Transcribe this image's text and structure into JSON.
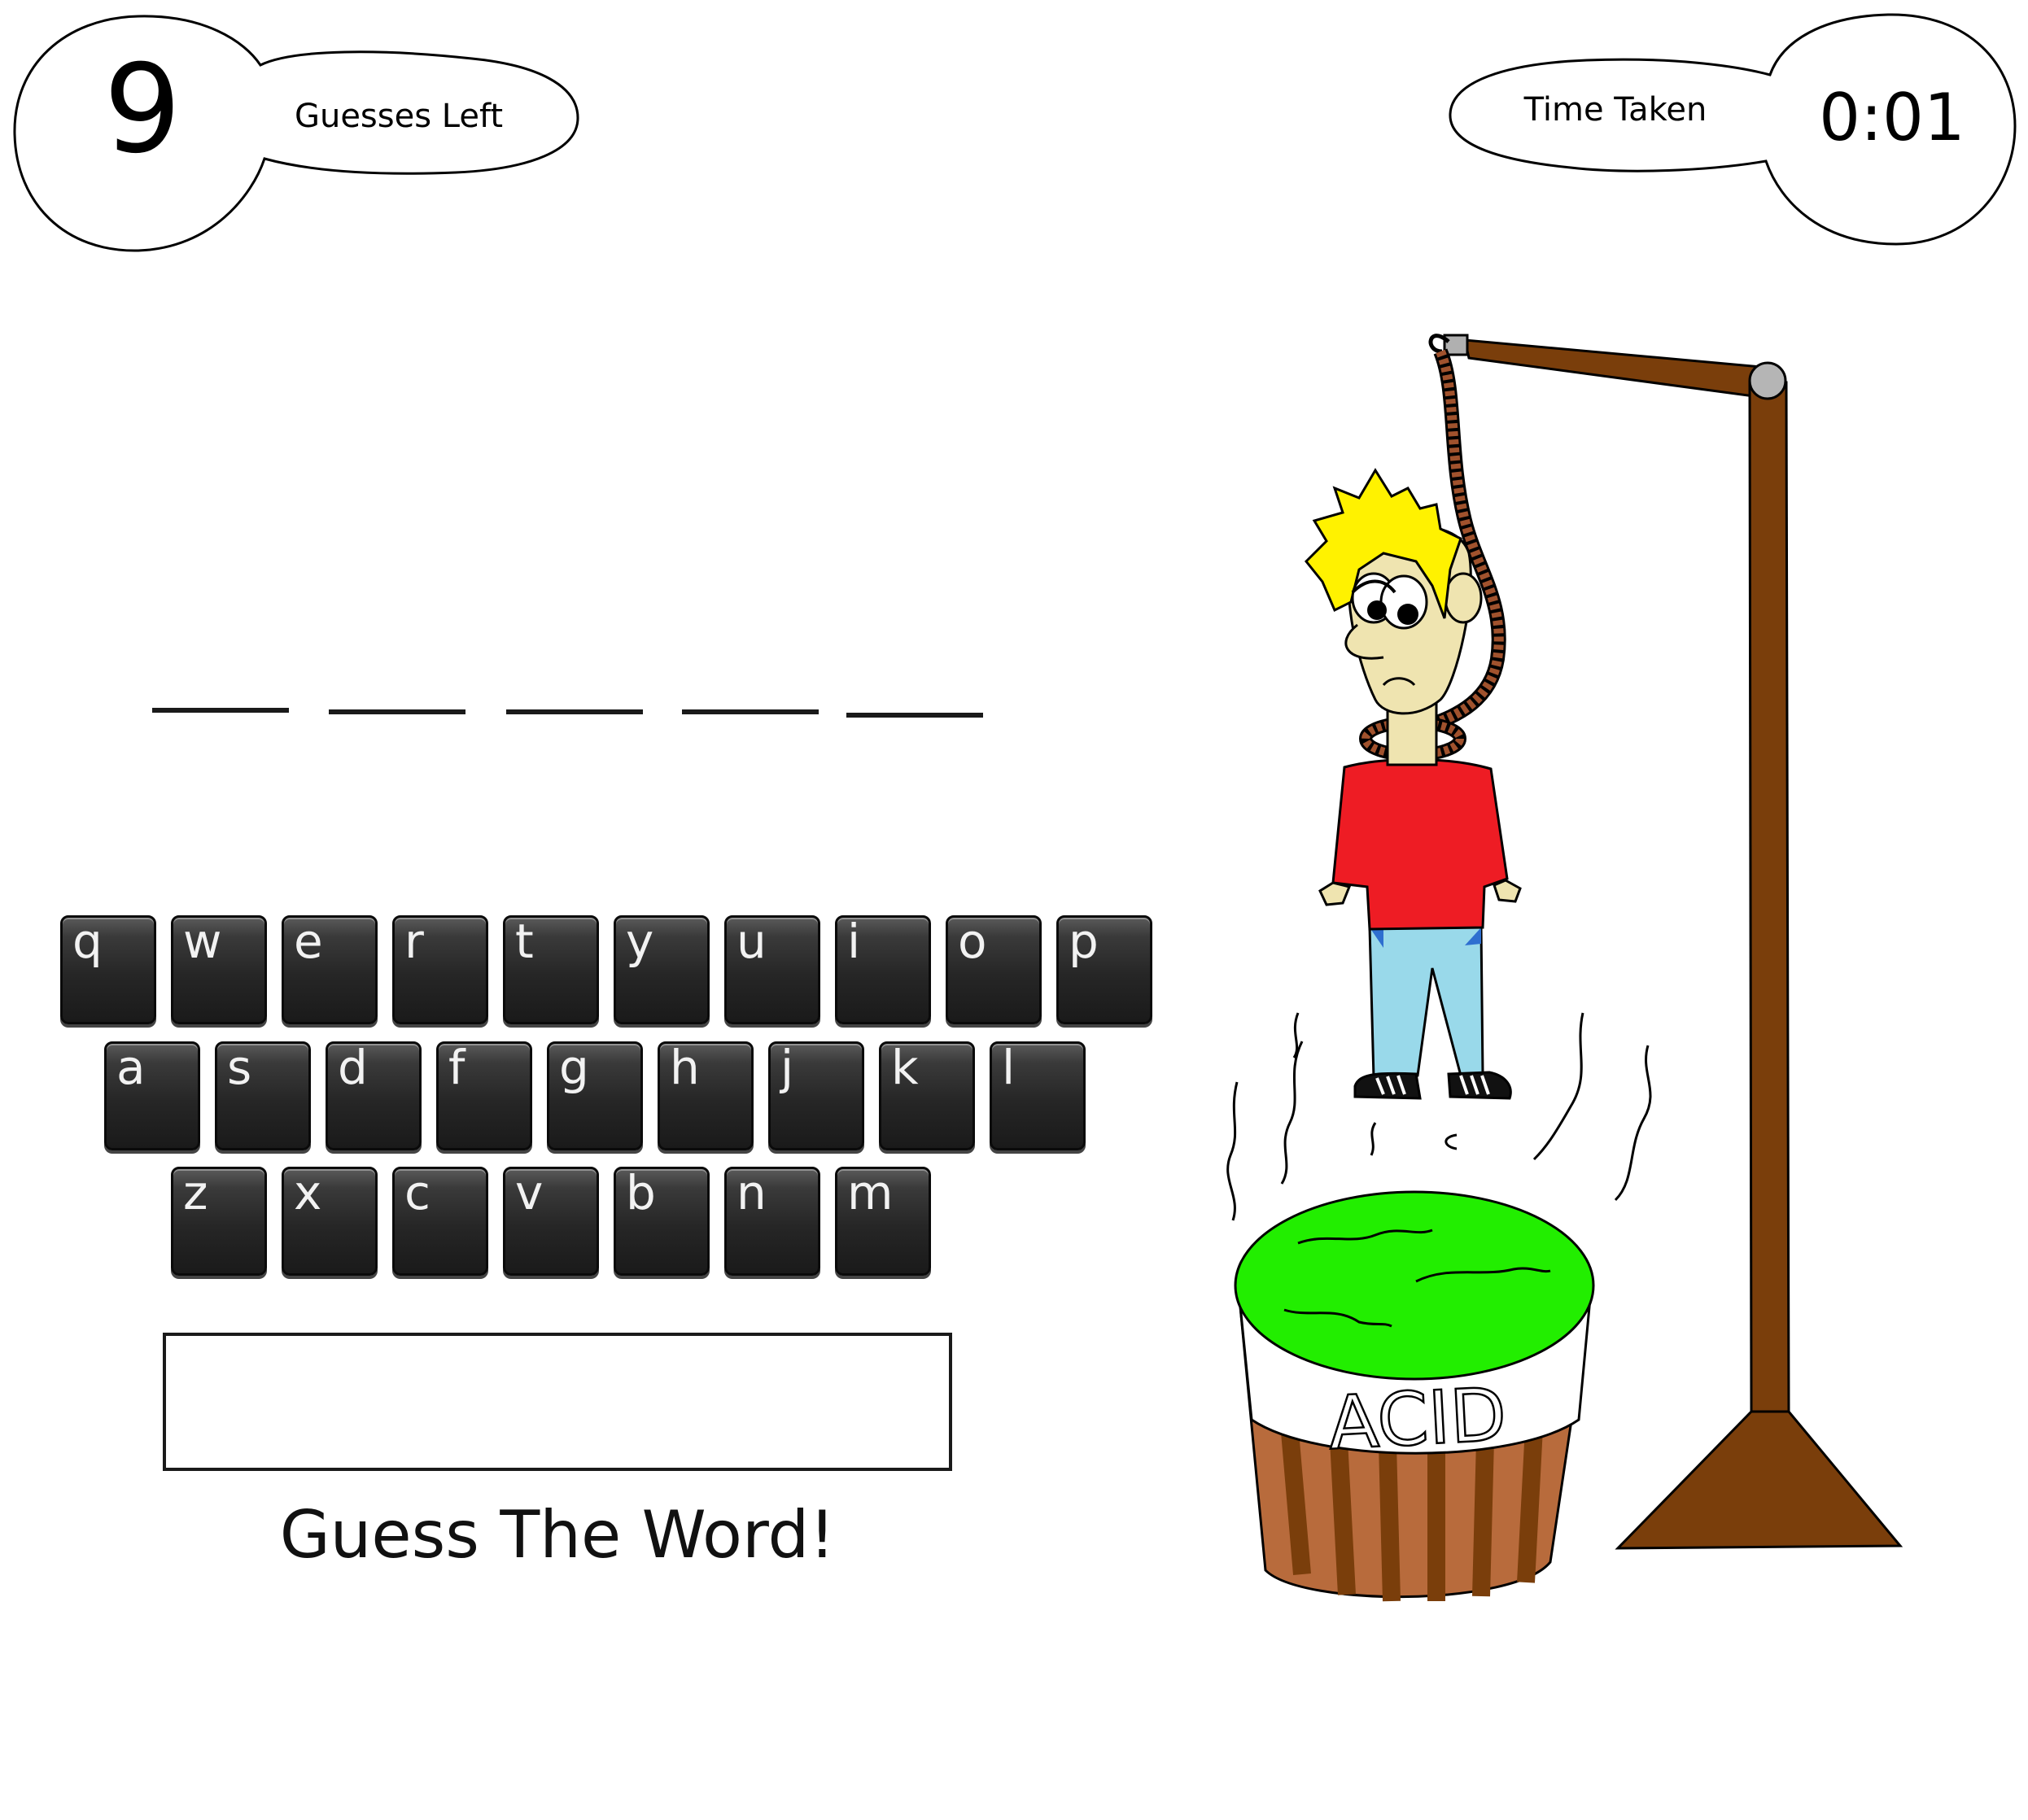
{
  "counter": {
    "value": "9",
    "label": "Guesses Left"
  },
  "timer": {
    "label": "Time Taken",
    "value": "0:01"
  },
  "word_slots": [
    "",
    "",
    "",
    "",
    ""
  ],
  "keyboard": {
    "row1": [
      "q",
      "w",
      "e",
      "r",
      "t",
      "y",
      "u",
      "i",
      "o",
      "p"
    ],
    "row2": [
      "a",
      "s",
      "d",
      "f",
      "g",
      "h",
      "j",
      "k",
      "l"
    ],
    "row3": [
      "z",
      "x",
      "c",
      "v",
      "b",
      "n",
      "m"
    ]
  },
  "guess_input": {
    "value": ""
  },
  "prompt": "Guess The Word!",
  "illustration": {
    "barrel_label": "ACID"
  },
  "colors": {
    "key_face": "#262626",
    "acid": "#22ee00",
    "gallows": "#7a3e0b",
    "shirt": "#ee1c24",
    "jeans": "#99d9ea",
    "hair": "#fff200"
  }
}
